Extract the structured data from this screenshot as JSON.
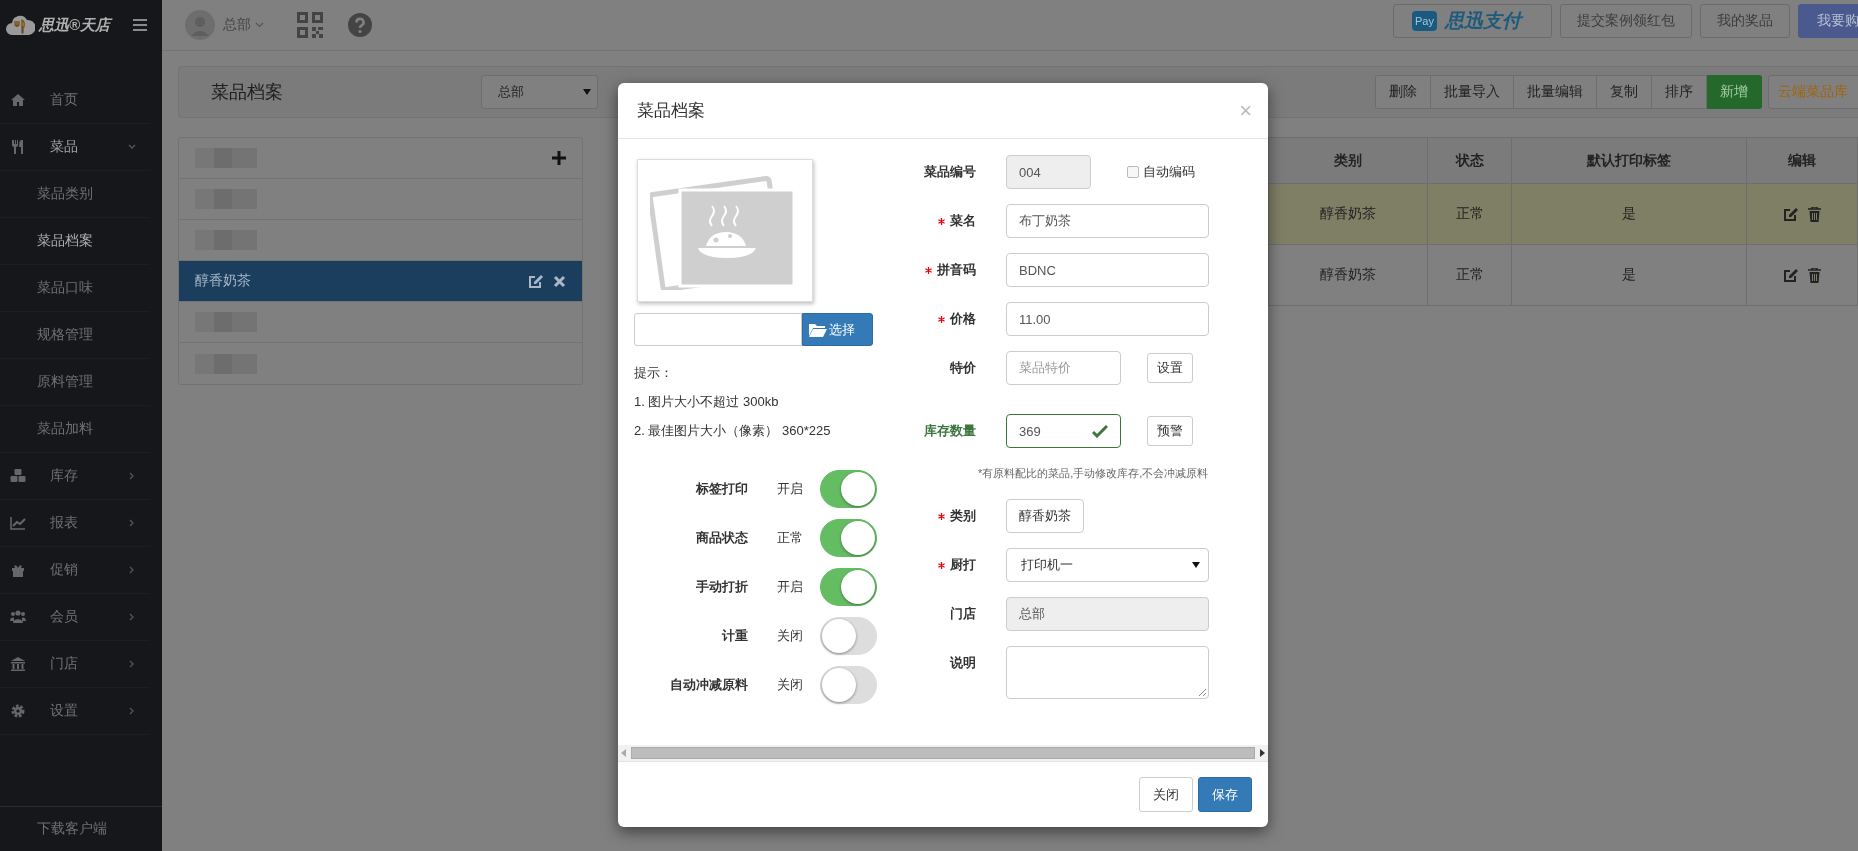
{
  "sidebar": {
    "logo": "思迅®天店",
    "items": [
      {
        "label": "首页"
      },
      {
        "label": "菜品",
        "expanded": true,
        "children": [
          {
            "label": "菜品类别",
            "selected": false
          },
          {
            "label": "菜品档案",
            "selected": true
          },
          {
            "label": "菜品口味",
            "selected": false
          },
          {
            "label": "规格管理",
            "selected": false
          },
          {
            "label": "原料管理",
            "selected": false
          },
          {
            "label": "菜品加料",
            "selected": false
          }
        ]
      },
      {
        "label": "库存",
        "expanded": false
      },
      {
        "label": "报表",
        "expanded": false
      },
      {
        "label": "促销",
        "expanded": false
      },
      {
        "label": "会员",
        "expanded": false
      },
      {
        "label": "门店",
        "expanded": false
      },
      {
        "label": "设置",
        "expanded": false
      }
    ],
    "footer": "下载客户端"
  },
  "topbar": {
    "store": "总部",
    "buttons": [
      {
        "kind": "pay",
        "badge": "Pay",
        "label": "思迅支付"
      },
      {
        "kind": "default",
        "label": "提交案例领红包"
      },
      {
        "kind": "default",
        "label": "我的奖品"
      },
      {
        "kind": "primary",
        "label": "我要购"
      }
    ]
  },
  "page_header": {
    "title": "菜品档案",
    "store_select": "总部",
    "actions": [
      {
        "kind": "default",
        "label": "删除"
      },
      {
        "kind": "default",
        "label": "批量导入"
      },
      {
        "kind": "default",
        "label": "批量编辑"
      },
      {
        "kind": "default",
        "label": "复制"
      },
      {
        "kind": "default",
        "label": "排序"
      },
      {
        "kind": "success",
        "label": "新增"
      },
      {
        "kind": "warning",
        "label": "云端菜品库"
      }
    ]
  },
  "category_panel": {
    "items": [
      {
        "kind": "blurred",
        "selected": false
      },
      {
        "kind": "blurred",
        "selected": false
      },
      {
        "kind": "text",
        "label": "醇香奶茶",
        "selected": true
      },
      {
        "kind": "blurred",
        "selected": false
      },
      {
        "kind": "blurred",
        "selected": false
      }
    ]
  },
  "table": {
    "columns": [
      "类别",
      "状态",
      "默认打印标签",
      "编辑"
    ],
    "rows": [
      {
        "cells": [
          "醇香奶茶",
          "正常",
          "是"
        ],
        "selected": true
      },
      {
        "cells": [
          "醇香奶茶",
          "正常",
          "是"
        ],
        "selected": false
      }
    ]
  },
  "dialog": {
    "title": "菜品档案",
    "close": "×",
    "choose_button": "选择",
    "hint_title": "提示：",
    "hints": [
      "1. 图片大小不超过 300kb",
      "2. 最佳图片大小（像素） 360*225"
    ],
    "toggles": [
      {
        "label": "标签打印",
        "status": "开启",
        "on": true
      },
      {
        "label": "商品状态",
        "status": "正常",
        "on": true
      },
      {
        "label": "手动打折",
        "status": "开启",
        "on": true
      },
      {
        "label": "计重",
        "status": "关闭",
        "on": false
      },
      {
        "label": "自动冲减原料",
        "status": "关闭",
        "on": false
      }
    ],
    "fields": [
      {
        "kind": "input",
        "label": "菜品编号",
        "required": false,
        "value": "004",
        "disabled": true,
        "valid": false,
        "checkbox": {
          "label": "自动编码",
          "checked": false
        }
      },
      {
        "kind": "input",
        "label": "菜名",
        "required": true,
        "value": "布丁奶茶",
        "disabled": false,
        "valid": false
      },
      {
        "kind": "input",
        "label": "拼音码",
        "required": true,
        "value": "BDNC",
        "disabled": false,
        "valid": false
      },
      {
        "kind": "input",
        "label": "价格",
        "required": true,
        "value": "11.00",
        "disabled": false,
        "valid": false
      },
      {
        "kind": "input",
        "label": "特价",
        "required": false,
        "placeholder": "菜品特价",
        "disabled": false,
        "valid": false,
        "action": "设置"
      },
      {
        "kind": "input",
        "label": "库存数量",
        "required": false,
        "value": "369",
        "disabled": false,
        "valid": true,
        "action": "预警"
      },
      {
        "kind": "note",
        "text": "*有原料配比的菜品,手动修改库存,不会冲减原料"
      },
      {
        "kind": "button",
        "label": "类别",
        "required": true,
        "value": "醇香奶茶"
      },
      {
        "kind": "select",
        "label": "厨打",
        "required": true,
        "value": "打印机一"
      },
      {
        "kind": "input",
        "label": "门店",
        "required": false,
        "value": "总部",
        "disabled": true,
        "valid": false
      },
      {
        "kind": "textarea",
        "label": "说明",
        "required": false
      }
    ],
    "buttons": [
      {
        "kind": "default",
        "label": "关闭"
      },
      {
        "kind": "primary",
        "label": "保存"
      }
    ]
  }
}
